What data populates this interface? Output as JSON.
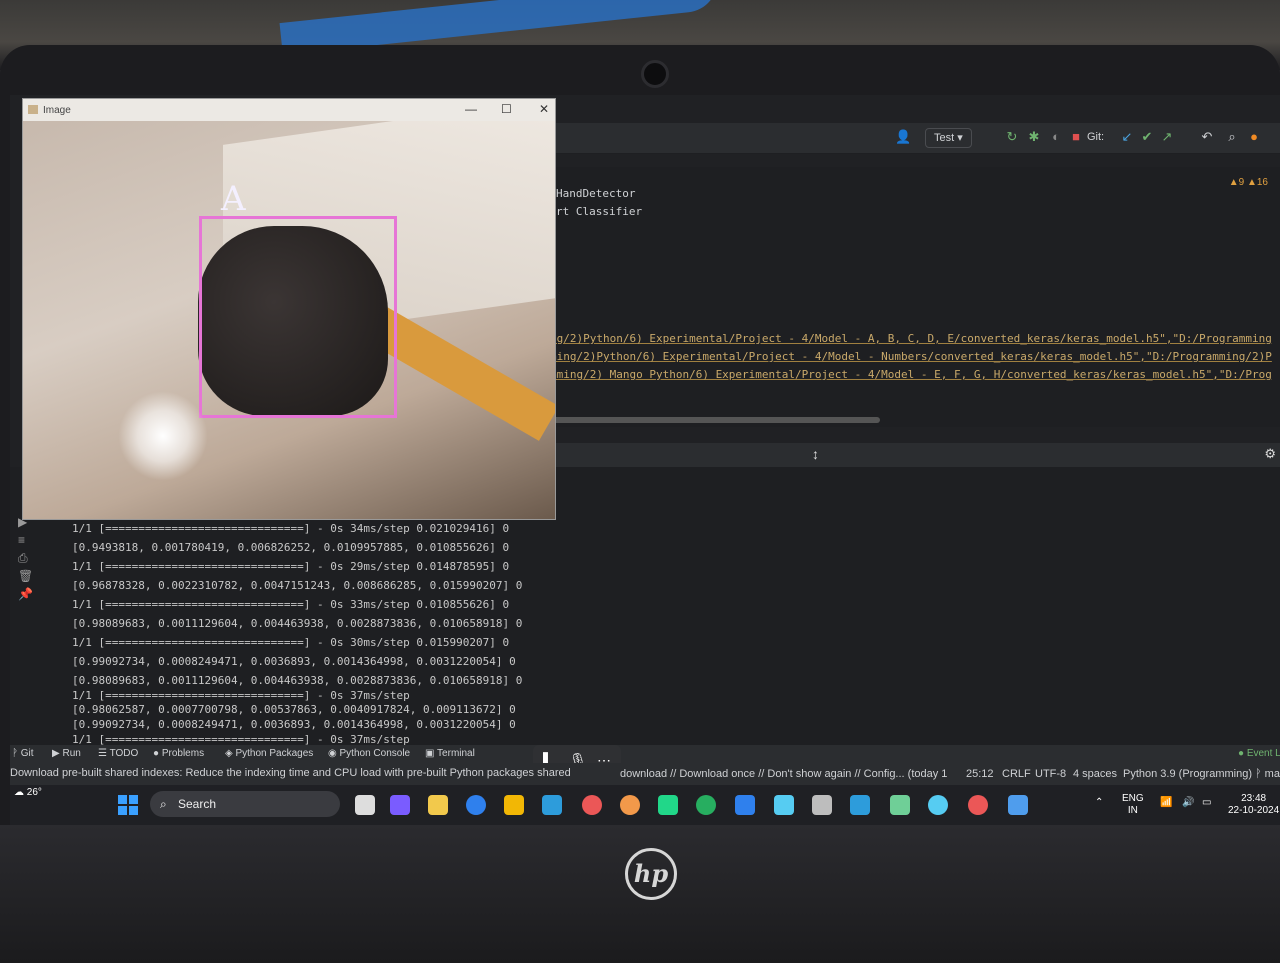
{
  "image_window": {
    "title": "Image",
    "detected_sign": "A",
    "controls": [
      "—",
      "☐",
      "✕"
    ]
  },
  "toolbar": {
    "run_config": "Test",
    "git_label": "Git:"
  },
  "editor": {
    "warnings": "▲9 ▲16",
    "imports": [
      "HandDetector",
      "rt Classifier"
    ],
    "model_paths": [
      "ng/2)Python/6) Experimental/Project - 4/Model - A, B, C, D, E/converted_keras/keras_model.h5\",\"D:/Programming",
      "ming/2)Python/6) Experimental/Project - 4/Model - Numbers/converted_keras/keras_model.h5\",\"D:/Programming/2)P",
      "mming/2) Mango Python/6) Experimental/Project - 4/Model - E, F, G, H/converted_keras/keras_model.h5\",\"D:/Prog"
    ]
  },
  "console": {
    "lines": [
      "1/1 [==============================] - 0s 34ms/step   0.021029416] 0",
      "[0.9493818, 0.001780419, 0.006826252, 0.0109957885, 0.010855626] 0",
      "1/1 [==============================] - 0s 29ms/step   0.014878595] 0",
      "[0.96878328, 0.0022310782, 0.0047151243, 0.008686285, 0.015990207] 0",
      "1/1 [==============================] - 0s 33ms/step   0.010855626] 0",
      "[0.98089683, 0.0011129604, 0.004463938, 0.0028873836, 0.010658918] 0",
      "1/1 [==============================] - 0s 30ms/step   0.015990207] 0",
      "[0.99092734, 0.0008249471, 0.0036893, 0.0014364998, 0.0031220054] 0",
      "[0.98089683, 0.0011129604, 0.004463938, 0.0028873836, 0.010658918] 0",
      "1/1 [==============================] - 0s 37ms/step",
      "[0.98062587, 0.0007700798, 0.00537863, 0.0040917824, 0.009113672] 0",
      "[0.99092734, 0.0008249471, 0.0036893, 0.0014364998, 0.0031220054] 0",
      "1/1 [==============================] - 0s 37ms/step"
    ]
  },
  "tool_tabs": [
    "Git",
    "Run",
    "TODO",
    "Problems",
    "Python Packages",
    "Python Console",
    "Terminal"
  ],
  "status_bar": {
    "message": "Download pre-built shared indexes: Reduce the indexing time and CPU load with pre-built Python packages shared",
    "message_cont": "download // Download once // Don't show again // Config... (today 1",
    "position": "25:12",
    "line_ending": "CRLF",
    "encoding": "UTF-8",
    "indent": "4 spaces",
    "interpreter": "Python 3.9 (Programming)",
    "branch": "ma",
    "event_log": "Event L"
  },
  "taskbar": {
    "weather": "26°",
    "search_placeholder": "Search",
    "language": "ENG",
    "region": "IN",
    "time": "23:48",
    "date": "22-10-2024"
  },
  "colors": {
    "bbox": "#e675d6",
    "console_bg": "#1e1f22",
    "taskbar_bg": "#1f2024"
  }
}
